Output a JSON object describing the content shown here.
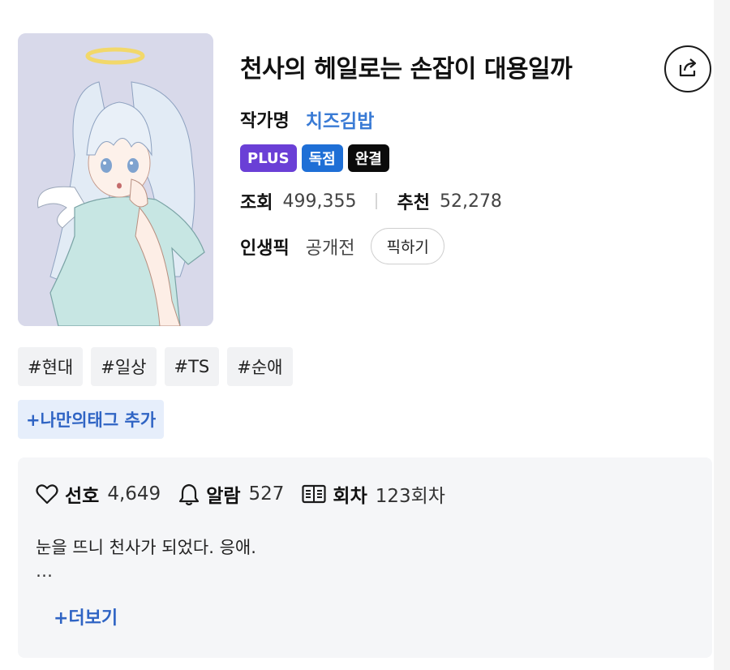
{
  "work": {
    "title": "천사의 헤일로는 손잡이 대용일까",
    "author_label": "작가명",
    "author_name": "치즈김밥",
    "badges": {
      "plus": "PLUS",
      "exclusive": "독점",
      "completed": "완결"
    },
    "views_label": "조회",
    "views": "499,355",
    "recommend_label": "추천",
    "recommend": "52,278",
    "pick_label": "인생픽",
    "pick_status": "공개전",
    "pick_button": "픽하기"
  },
  "tags": [
    "#현대",
    "#일상",
    "#TS",
    "#순애"
  ],
  "add_tag_label": "+나만의태그 추가",
  "card": {
    "like_label": "선호",
    "like_count": "4,649",
    "alarm_label": "알람",
    "alarm_count": "527",
    "episodes_label": "회차",
    "episodes_count": "123회차",
    "synopsis": "눈을 뜨니 천사가 되었다. 응애.",
    "ellipsis": "…",
    "more_label": "+더보기"
  },
  "icons": [
    "share-icon",
    "heart-icon",
    "bell-icon",
    "episodes-icon"
  ],
  "colors": {
    "author": "#3a7bd5",
    "plus": "#6a3fd6",
    "exclusive": "#1e6fd6",
    "completed": "#0b0b0b",
    "link": "#2f64c4"
  }
}
